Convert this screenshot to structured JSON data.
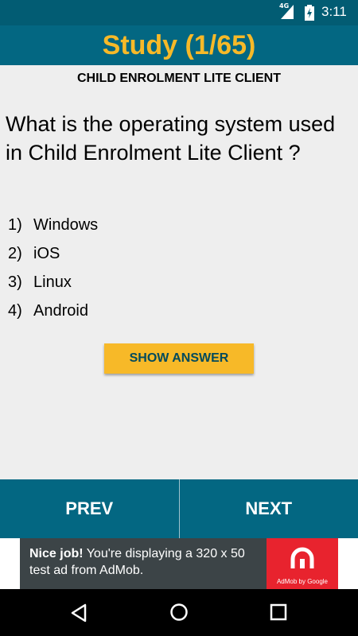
{
  "status_bar": {
    "network_label": "4G",
    "time": "3:11",
    "icons": [
      "signal-icon",
      "battery-charging-icon"
    ]
  },
  "header": {
    "title": "Study (1/65)"
  },
  "subject": "CHILD ENROLMENT LITE CLIENT",
  "question": "What is the operating system used in Child Enrolment Lite Client ?",
  "options": [
    {
      "num": "1)",
      "text": "Windows"
    },
    {
      "num": "2)",
      "text": "iOS"
    },
    {
      "num": "3)",
      "text": "Linux"
    },
    {
      "num": "4)",
      "text": "Android"
    }
  ],
  "show_answer_label": "SHOW ANSWER",
  "nav": {
    "prev_label": "PREV",
    "next_label": "NEXT"
  },
  "ad": {
    "headline": "Nice job!",
    "body": " You're displaying a 320 x 50 test ad from AdMob.",
    "brand": "AdMob by Google"
  },
  "system_nav": {
    "icons": [
      "back-icon",
      "home-icon",
      "recents-icon"
    ]
  },
  "colors": {
    "primary_dark": "#025c73",
    "primary": "#036782",
    "accent": "#f7b928",
    "background": "#eeeeee",
    "ad_background": "#3c4447",
    "ad_logo": "#e8232e"
  }
}
